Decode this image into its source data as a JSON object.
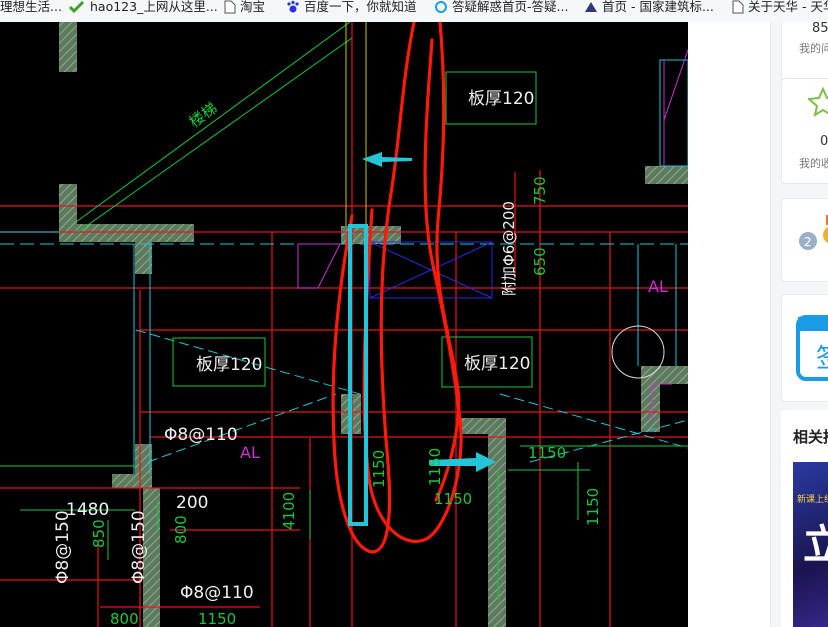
{
  "bookmarks": [
    {
      "label": "理想生活...",
      "icon": "bookmark-icon"
    },
    {
      "label": "hao123_上网从这里...",
      "icon": "hao123-logo-icon"
    },
    {
      "label": "淘宝",
      "icon": "page-icon"
    },
    {
      "label": "百度一下，你就知道",
      "icon": "baidu-paw-icon"
    },
    {
      "label": "答疑解惑首页-答疑...",
      "icon": "qa-icon"
    },
    {
      "label": "首页 - 国家建筑标...",
      "icon": "building-icon"
    },
    {
      "label": "关于天华 - 天华",
      "icon": "page-icon"
    }
  ],
  "cad": {
    "labels": {
      "slab_top": "板厚120",
      "slab_left": "板厚120",
      "slab_mid": "板厚120",
      "diag": "楼梯",
      "d750": "750",
      "d650": "650",
      "rebar_vertical": "附加Φ6@200",
      "al_right": "AL",
      "al_left": "AL",
      "rebar_8_110_a": "Φ8@110",
      "rebar_8_110_b": "Φ8@110",
      "d1480": "1480",
      "d200": "200",
      "d850": "850",
      "d800a": "800",
      "d4100": "4100",
      "rebar_8_150_a": "Φ8@150",
      "rebar_8_150_b": "Φ8@150",
      "d1150a": "1150",
      "d1150b": "1150",
      "d1150c": "1150",
      "d1150d": "1150",
      "d1150e": "1150",
      "d1150f": "1150",
      "d800b": "800"
    }
  },
  "sidebar": {
    "count_top": "85",
    "label_top": "我的问",
    "count_mid": "0",
    "label_mid": "我的收",
    "badge_count": "2",
    "calendar_char": "签",
    "related_title": "相关推",
    "promo_text": "新课上线",
    "promo_big": "立"
  },
  "colors": {
    "background": "#000000",
    "red_axis": "#e8141c",
    "green_dim": "#18c83c",
    "cyan_line": "#18c8d8",
    "magenta": "#d030d8",
    "white_text": "#f0f0f0",
    "hatch_wall": "#7e9c7e",
    "annotation_red": "#ff1a0a",
    "highlight_cyan": "#22c6d8"
  }
}
